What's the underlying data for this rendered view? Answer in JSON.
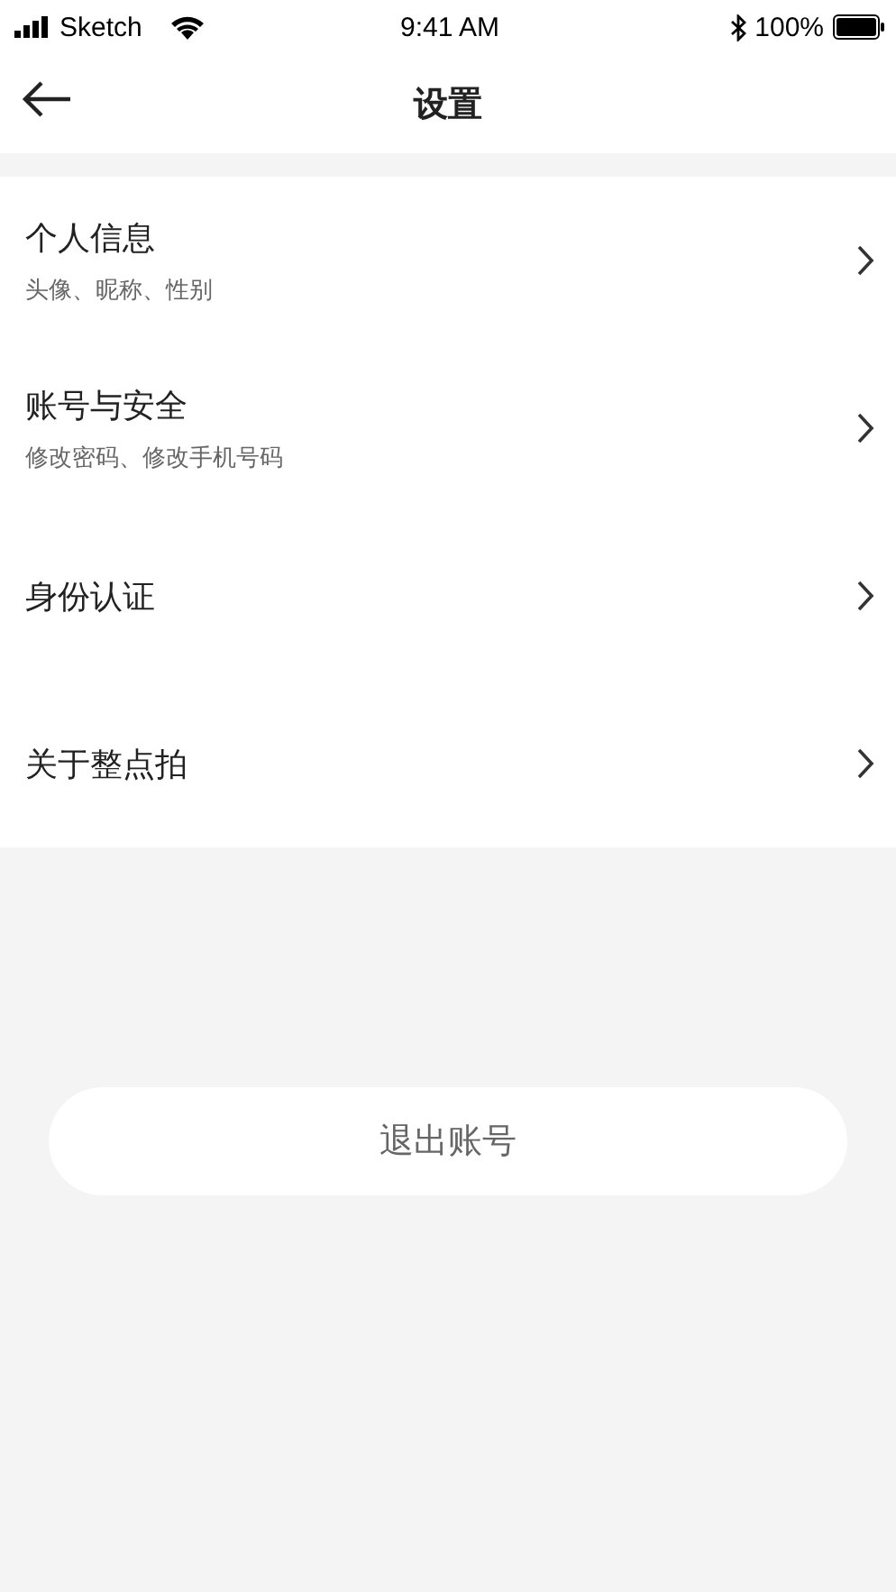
{
  "status_bar": {
    "carrier": "Sketch",
    "time": "9:41 AM",
    "battery": "100%"
  },
  "nav": {
    "title": "设置"
  },
  "items": [
    {
      "title": "个人信息",
      "subtitle": "头像、昵称、性别"
    },
    {
      "title": "账号与安全",
      "subtitle": "修改密码、修改手机号码"
    },
    {
      "title": "身份认证"
    },
    {
      "title": "关于整点拍"
    }
  ],
  "logout": {
    "label": "退出账号"
  }
}
